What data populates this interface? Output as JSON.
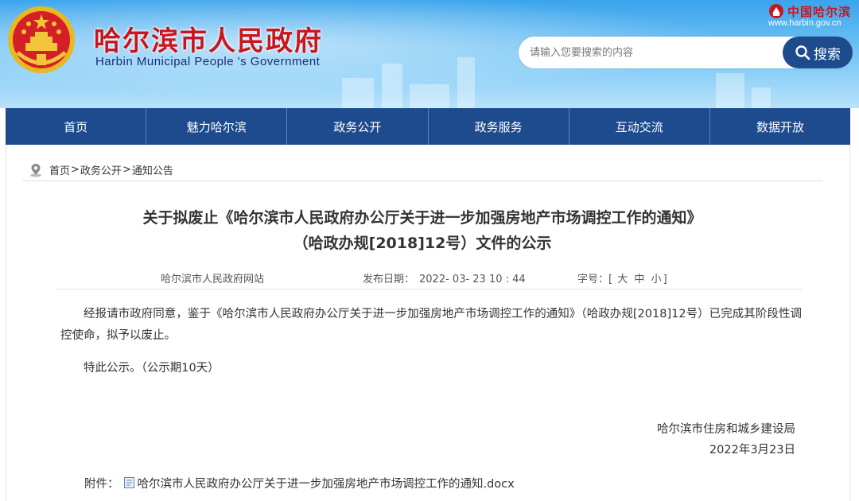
{
  "header": {
    "site_name_cn": "哈尔滨市人民政府",
    "site_name_en": "Harbin Municipal People 's Government",
    "brand_logo_text": "中国哈尔滨",
    "domain": "www.harbin.gov.cn",
    "search": {
      "placeholder": "请输入您要搜索的内容",
      "button_label": "搜索"
    }
  },
  "nav": {
    "items": [
      "首页",
      "魅力哈尔滨",
      "政务公开",
      "政务服务",
      "互动交流",
      "数据开放"
    ]
  },
  "breadcrumb": {
    "items": [
      "首页",
      "政务公开",
      "通知公告"
    ],
    "separator": ">"
  },
  "article": {
    "title_line1": "关于拟废止《哈尔滨市人民政府办公厅关于进一步加强房地产市场调控工作的通知》",
    "title_line2": "（哈政办规[2018]12号）文件的公示",
    "meta": {
      "source": "哈尔滨市人民政府网站",
      "date_label": "发布日期：",
      "date_value": "2022- 03- 23    10 : 44",
      "fontsize_label": "字号：",
      "fontsize_open": "[",
      "fontsize_large": "大",
      "fontsize_medium": "中",
      "fontsize_small": "小",
      "fontsize_close": "]"
    },
    "paragraph1": "经报请市政府同意，鉴于《哈尔滨市人民政府办公厅关于进一步加强房地产市场调控工作的通知》（哈政办规[2018]12号）已完成其阶段性调控使命，拟予以废止。",
    "paragraph2": "特此公示。（公示期10天）",
    "signature_dept": "哈尔滨市住房和城乡建设局",
    "signature_date": "2022年3月23日",
    "attachment_label": "附件：",
    "attachment_file": "哈尔滨市人民政府办公厅关于进一步加强房地产市场调控工作的通知.docx"
  },
  "colors": {
    "nav_bg": "#1d4b8e",
    "title_red": "#c8161e",
    "sky": "#3aa4ec"
  }
}
